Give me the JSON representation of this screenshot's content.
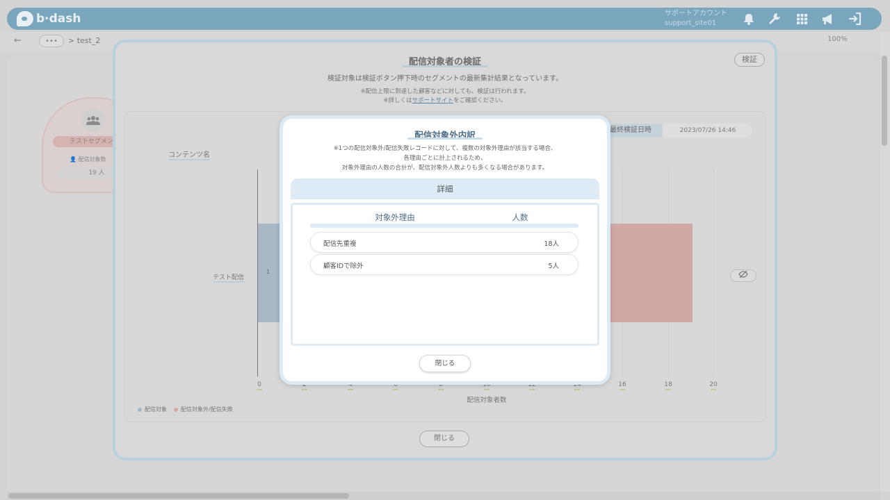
{
  "header": {
    "logo_text": "b∙dash",
    "account_line1": "サポートアカウント",
    "account_line2": "support_site01",
    "icons": [
      "bell-icon",
      "wrench-icon",
      "grid-icon",
      "megaphone-icon",
      "logout-icon"
    ]
  },
  "toolbar": {
    "back_icon": "←",
    "crumb_dots": "•••",
    "crumb_text": "> test_2",
    "zoom": "100%"
  },
  "segment_node": {
    "label": "テストセグメント",
    "sub_label": "配信対象数",
    "count": "19 人"
  },
  "verify_modal": {
    "title": "配信対象者の検証",
    "verify_button": "検証",
    "description": "検証対象は検証ボタン押下時のセグメントの最新集計結果となっています。",
    "note1": "※配信上限に到達した顧客などに対しても、検証は行われます。",
    "note2_prefix": "※詳しくは",
    "note2_link": "サポートサイト",
    "note2_suffix": "をご確認ください。",
    "last_verified_label": "最終検証日時",
    "last_verified_value": "2023/07/26 14:46",
    "close_button": "閉じる"
  },
  "chart_data": {
    "type": "bar",
    "orientation": "horizontal",
    "stacked": true,
    "ylabel": "コンテンツ名",
    "xlabel": "配信対象者数",
    "categories": [
      "テスト配信"
    ],
    "series": [
      {
        "name": "配信対象",
        "values": [
          1
        ],
        "color": "#a8c4dc"
      },
      {
        "name": "配信対象外/配信失敗",
        "values": [
          18
        ],
        "color": "#e0a9a6"
      }
    ],
    "bar_label": "1",
    "xlim": [
      0,
      20
    ],
    "xticks": [
      "0",
      "2",
      "4",
      "6",
      "8",
      "10",
      "12",
      "14",
      "16",
      "18",
      "20"
    ],
    "grid": true,
    "legend": "bottom-left"
  },
  "detail_modal": {
    "title": "配信対象外内訳",
    "note_line1": "※1つの配信対象外/配信失敗レコードに対して、複数の対象外理由が該当する場合、",
    "note_line2": "各理由ごとに計上されるため、",
    "note_line3": "対象外理由の人数の合計が、配信対象外人数よりも多くなる場合があります。",
    "section_header": "詳細",
    "col_reason": "対象外理由",
    "col_count": "人数",
    "rows": [
      {
        "reason": "配信先重複",
        "count": "18人"
      },
      {
        "reason": "顧客IDで除外",
        "count": "5人"
      }
    ],
    "close_button": "閉じる"
  }
}
